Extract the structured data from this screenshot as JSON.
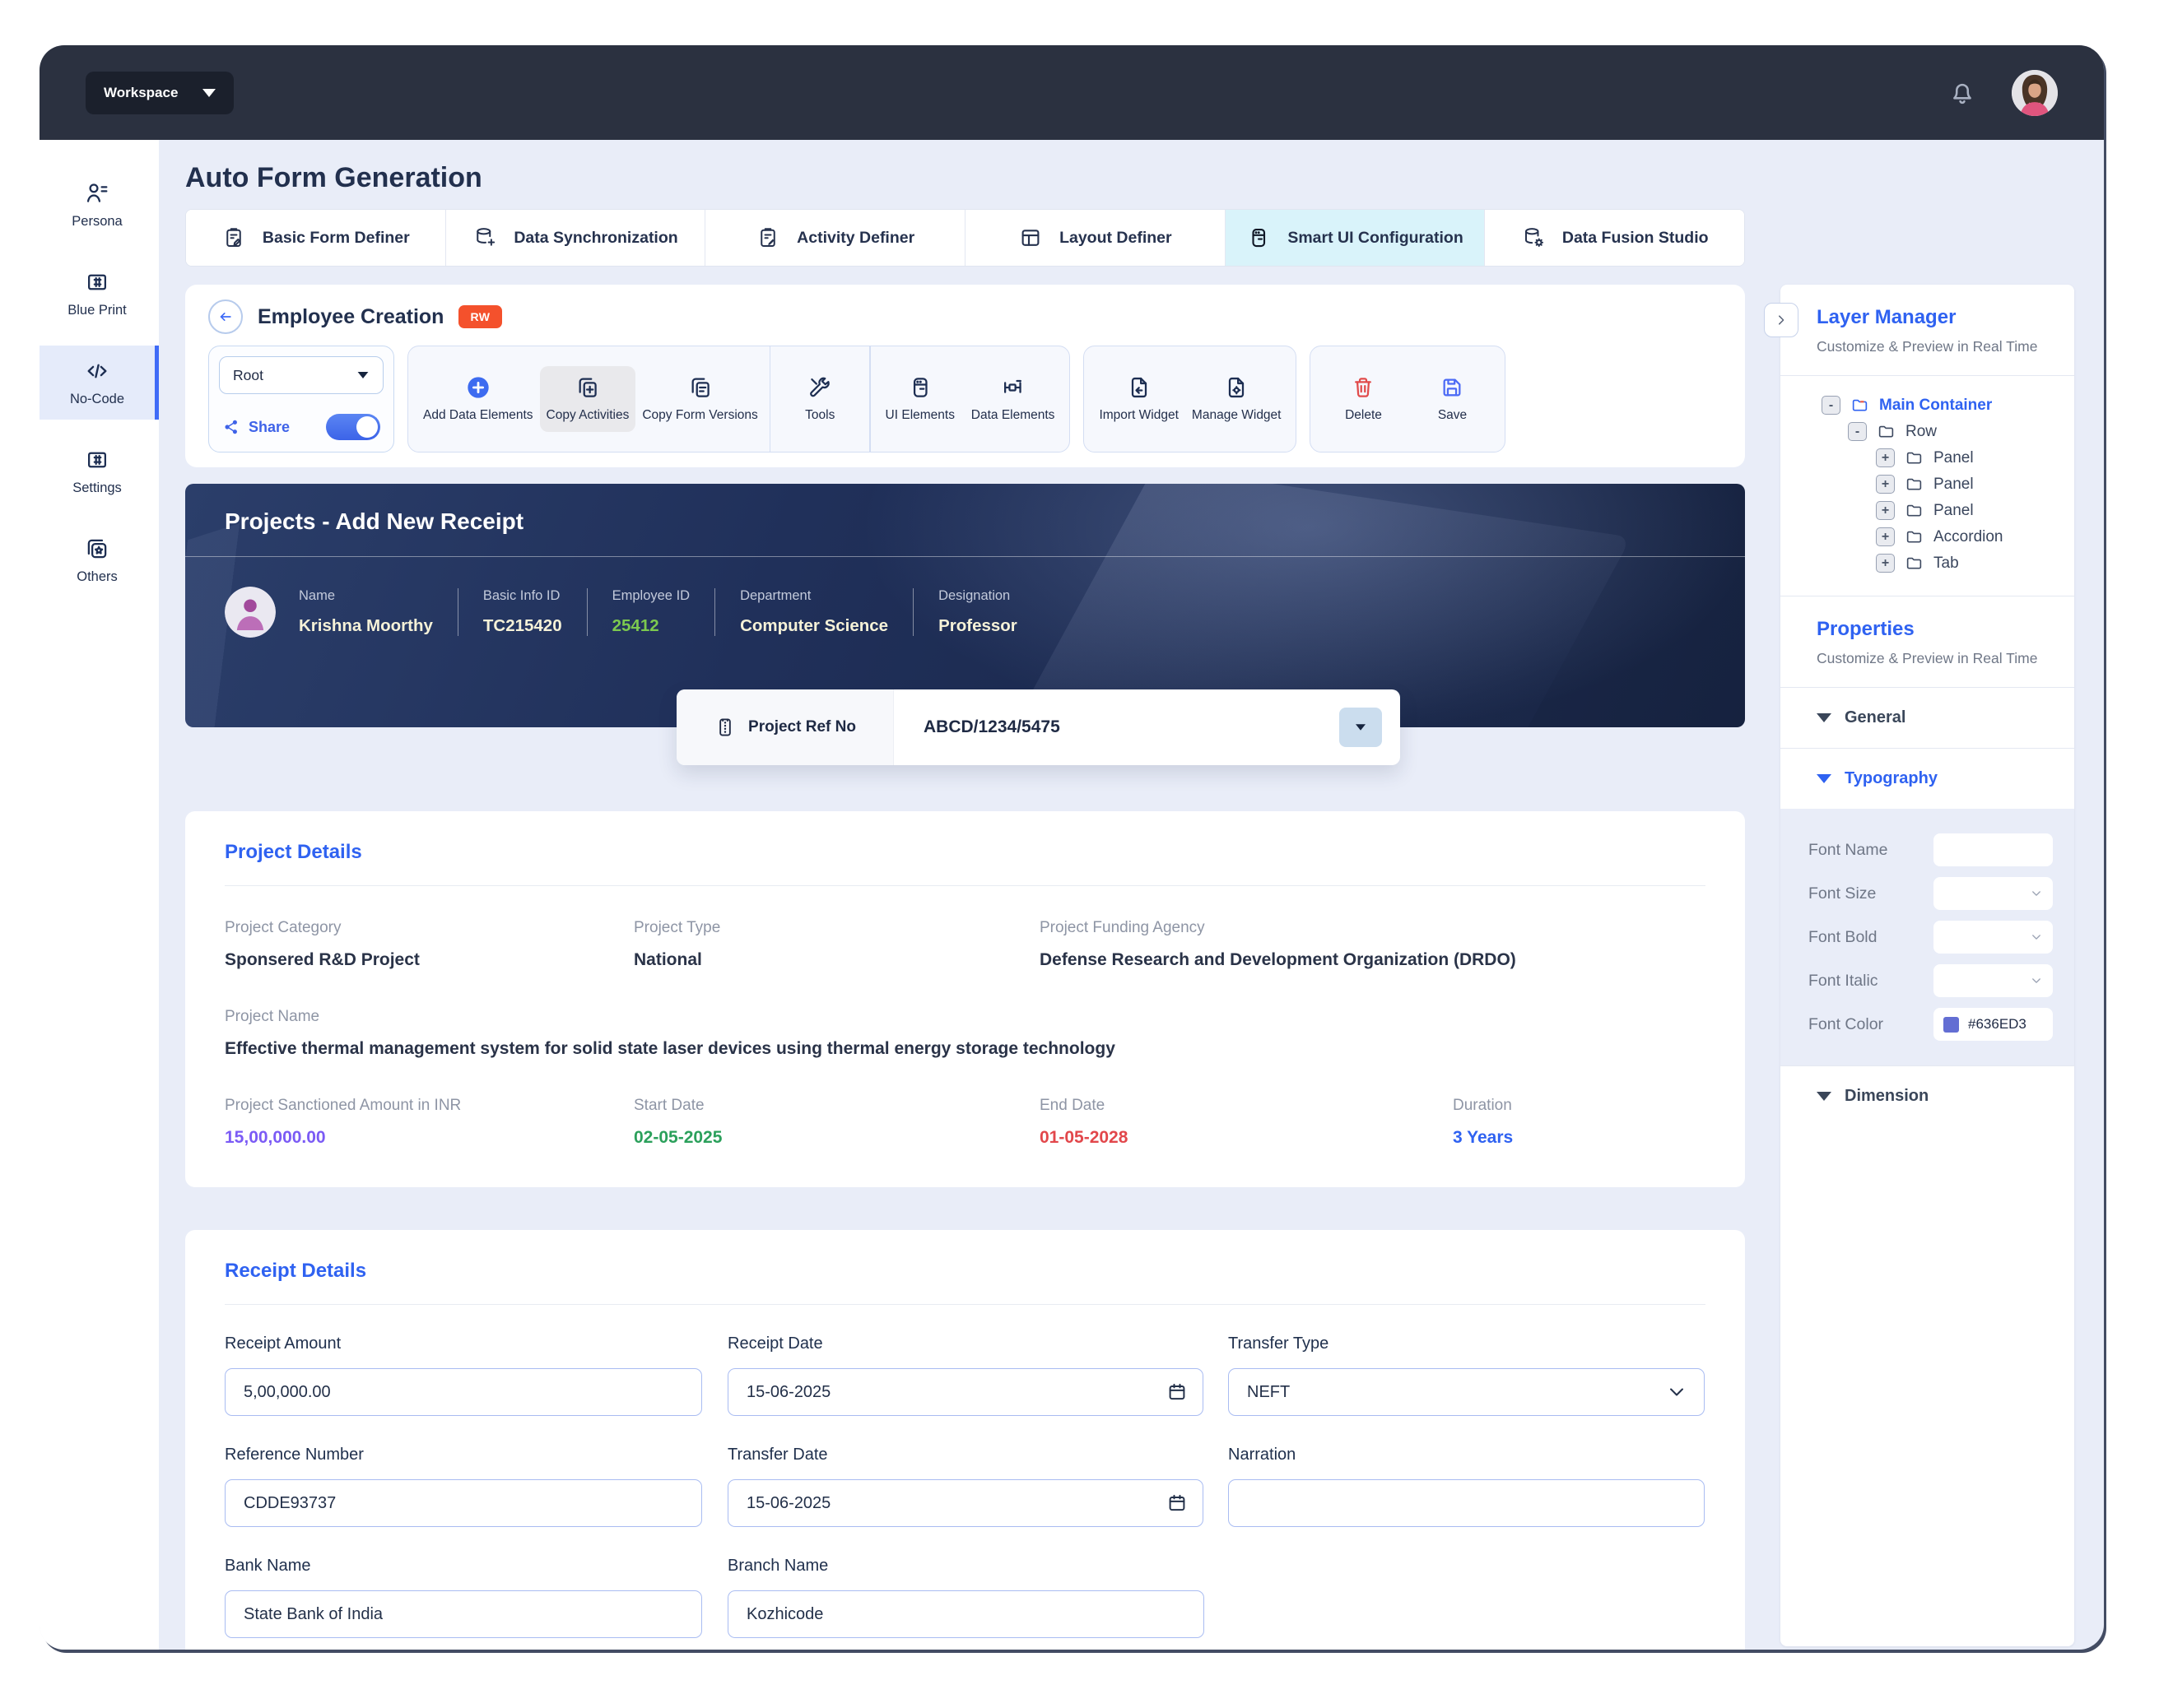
{
  "topbar": {
    "workspace_label": "Workspace"
  },
  "sidebar": {
    "items": [
      {
        "label": "Persona"
      },
      {
        "label": "Blue Print"
      },
      {
        "label": "No-Code"
      },
      {
        "label": "Settings"
      },
      {
        "label": "Others"
      }
    ]
  },
  "header": {
    "title": "Auto Form Generation"
  },
  "tabs": {
    "items": [
      {
        "label": "Basic Form Definer"
      },
      {
        "label": "Data Synchronization"
      },
      {
        "label": "Activity Definer"
      },
      {
        "label": "Layout Definer"
      },
      {
        "label": "Smart UI Configuration",
        "active": true
      },
      {
        "label": "Data Fusion Studio"
      }
    ]
  },
  "builder": {
    "form_name": "Employee Creation",
    "access_badge": "RW",
    "root_value": "Root",
    "share_label": "Share",
    "share_toggle_state": "on",
    "tools": [
      {
        "label": "Add Data Elements"
      },
      {
        "label": "Copy Activities"
      },
      {
        "label": "Copy Form Versions"
      },
      {
        "label": "Tools"
      },
      {
        "label": "UI Elements"
      },
      {
        "label": "Data Elements"
      },
      {
        "label": "Import Widget"
      },
      {
        "label": "Manage Widget"
      },
      {
        "label": "Delete"
      },
      {
        "label": "Save"
      }
    ]
  },
  "banner": {
    "title": "Projects - Add New Receipt",
    "fields": [
      {
        "label": "Name",
        "value": "Krishna Moorthy"
      },
      {
        "label": "Basic Info ID",
        "value": "TC215420"
      },
      {
        "label": "Employee ID",
        "value": "25412"
      },
      {
        "label": "Department",
        "value": "Computer Science"
      },
      {
        "label": "Designation",
        "value": "Professor"
      }
    ]
  },
  "ref": {
    "label": "Project Ref No",
    "value": "ABCD/1234/5475"
  },
  "project": {
    "title": "Project Details",
    "category_label": "Project Category",
    "category": "Sponsered R&D Project",
    "type_label": "Project Type",
    "type": "National",
    "agency_label": "Project Funding Agency",
    "agency": "Defense Research and Development Organization (DRDO)",
    "name_label": "Project Name",
    "name": "Effective thermal management system for solid state laser devices using thermal energy storage technology",
    "amount_label": "Project Sanctioned Amount in INR",
    "amount": "15,00,000.00",
    "start_label": "Start Date",
    "start": "02-05-2025",
    "end_label": "End Date",
    "end": "01-05-2028",
    "duration_label": "Duration",
    "duration": "3 Years"
  },
  "receipt": {
    "title": "Receipt Details",
    "amount_label": "Receipt Amount",
    "amount_value": "5,00,000.00",
    "date_label": "Receipt Date",
    "date_value": "15-06-2025",
    "type_label": "Transfer Type",
    "type_value": "NEFT",
    "refno_label": "Reference Number",
    "refno_value": "CDDE93737",
    "tdate_label": "Transfer Date",
    "tdate_value": "15-06-2025",
    "narration_label": "Narration",
    "narration_value": "",
    "bank_label": "Bank Name",
    "bank_value": "State Bank of India",
    "branch_label": "Branch Name",
    "branch_value": "Kozhicode"
  },
  "layer_manager": {
    "title": "Layer Manager",
    "subtitle": "Customize & Preview in Real Time",
    "tree": [
      {
        "toggle": "-",
        "label": "Main Container"
      },
      {
        "toggle": "-",
        "label": "Row"
      },
      {
        "toggle": "+",
        "label": "Panel"
      },
      {
        "toggle": "+",
        "label": "Panel"
      },
      {
        "toggle": "+",
        "label": "Panel"
      },
      {
        "toggle": "+",
        "label": "Accordion"
      },
      {
        "toggle": "+",
        "label": "Tab"
      }
    ]
  },
  "properties": {
    "title": "Properties",
    "subtitle": "Customize & Preview in Real Time",
    "general_label": "General",
    "typography_label": "Typography",
    "dimension_label": "Dimension",
    "font_name_label": "Font Name",
    "font_size_label": "Font Size",
    "font_bold_label": "Font Bold",
    "font_italic_label": "Font Italic",
    "font_color_label": "Font Color",
    "font_color_value": "#636ED3"
  },
  "colors": {
    "accent_blue": "#2F62F1",
    "badge_orange": "#F4512C",
    "font_swatch": "#636ED3",
    "active_tab": "#D9F3FA",
    "topbar": "#2B3140"
  }
}
